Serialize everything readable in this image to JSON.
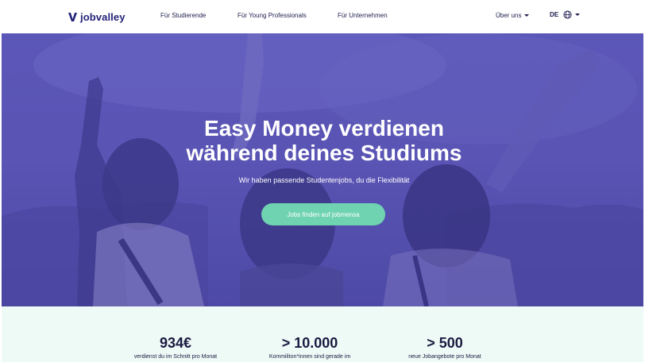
{
  "header": {
    "logo_text": "jobvalley",
    "nav": {
      "students": "Für Studierende",
      "young_professionals": "Für Young Professionals",
      "companies": "Für Unternehmen",
      "about": "Über uns"
    },
    "language": "DE"
  },
  "hero": {
    "title_line1": "Easy Money verdienen",
    "title_line2": "während deines Studiums",
    "subtitle": "Wir haben passende Studentenjobs, du die Flexibilität",
    "cta_label": "Jobs finden auf jobmensa"
  },
  "stats": [
    {
      "value": "934€",
      "label": "verdienst du im Schnitt pro Monat"
    },
    {
      "value": "> 10.000",
      "label": "Kommiliton*innen sind gerade im"
    },
    {
      "value": "> 500",
      "label": "neue Jobangebote pro Monat"
    }
  ],
  "colors": {
    "brand": "#23237a",
    "hero_overlay": "#5a54b4",
    "cta": "#6fd3b1",
    "stats_bg": "#eefaf6"
  }
}
